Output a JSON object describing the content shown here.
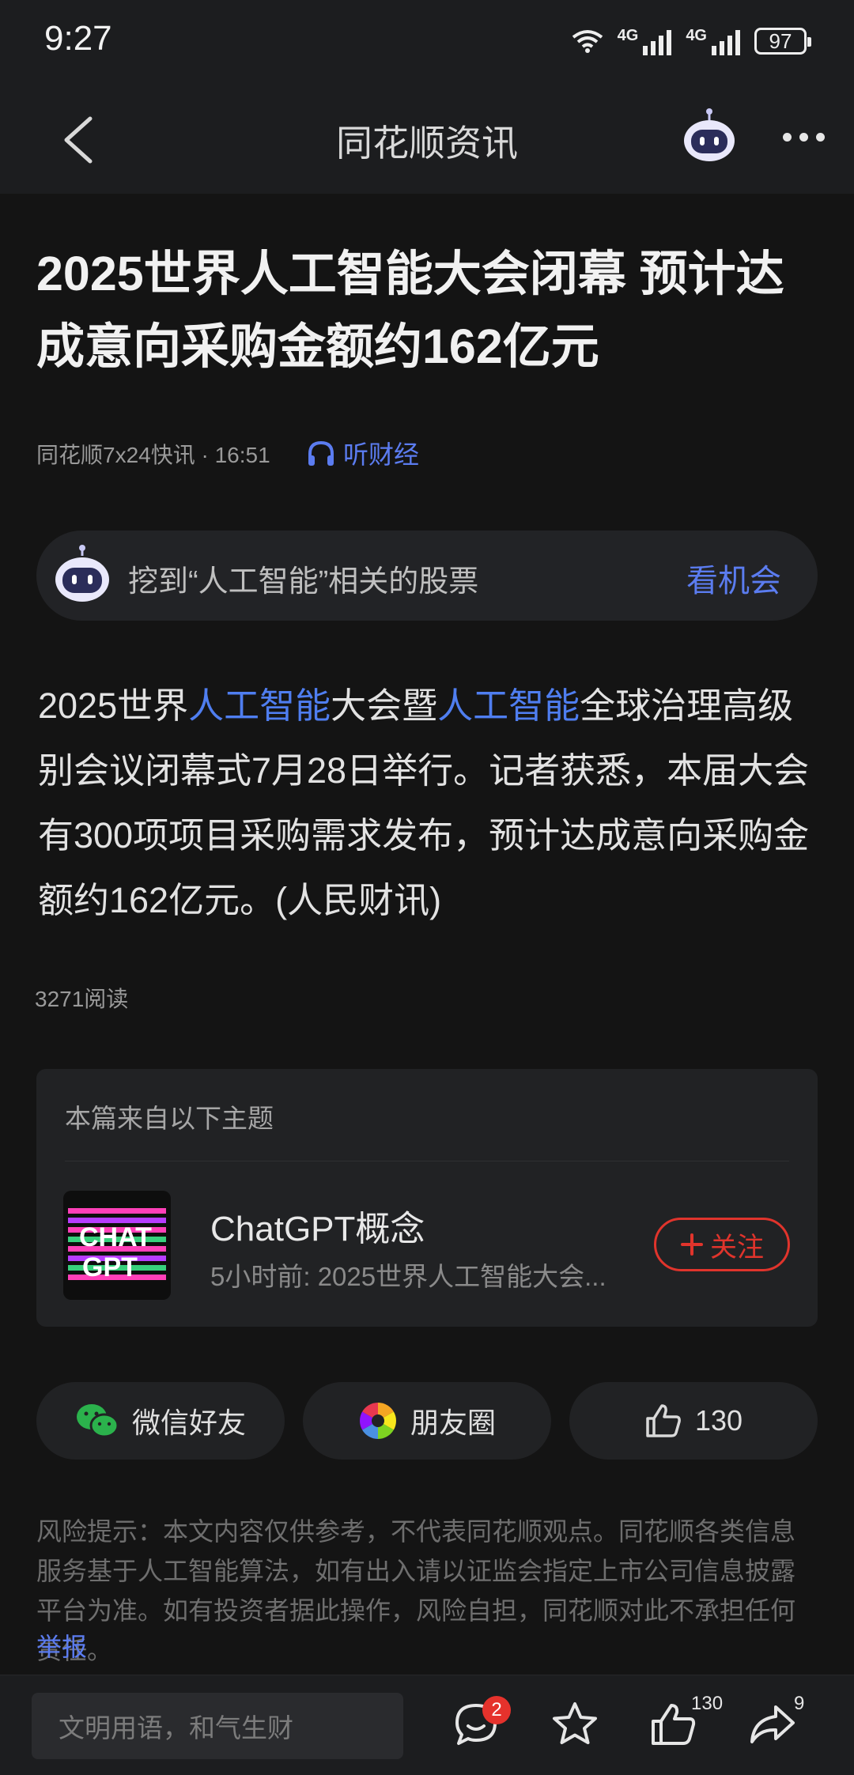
{
  "status_bar": {
    "time": "9:27",
    "network_1": "4G",
    "network_2": "4G",
    "battery": "97"
  },
  "nav": {
    "title": "同花顺资讯"
  },
  "article": {
    "headline": "2025世界人工智能大会闭幕 预计达成意向采购金额约162亿元",
    "source_time": "同花顺7x24快讯 · 16:51",
    "listen_label": "听财经",
    "ai_prompt": "挖到“人工智能”相关的股票",
    "ai_link": "看机会",
    "body": {
      "p1": "2025世界",
      "kw1": "人工智能",
      "p2": "大会暨",
      "kw2": "人工智能",
      "p3": "全球治理高级别会议闭幕式7月28日举行。记者获悉，本届大会有300项项目采购需求发布，预计达成意向采购金额约162亿元。(人民财讯)"
    },
    "reads": "3271阅读"
  },
  "topic": {
    "header": "本篇来自以下主题",
    "thumb_text_1": "CHAT",
    "thumb_text_2": "GPT",
    "name": "ChatGPT概念",
    "desc": "5小时前: 2025世界人工智能大会...",
    "follow_label": "关注"
  },
  "share": {
    "wechat_label": "微信好友",
    "moments_label": "朋友圈",
    "like_count": "130"
  },
  "disclaimer": {
    "text": "风险提示：本文内容仅供参考，不代表同花顺观点。同花顺各类信息服务基于人工智能算法，如有出入请以证监会指定上市公司信息披露平台为准。如有投资者据此操作，风险自担，同花顺对此不承担任何责任。",
    "report_label": "举报"
  },
  "bottom_bar": {
    "comment_placeholder": "文明用语，和气生财",
    "comment_badge": "2",
    "like_count": "130",
    "share_count": "9"
  },
  "colors": {
    "accent_blue": "#5b7cf0",
    "keyword_blue": "#4f7ef0",
    "follow_red": "#e0342c",
    "background": "#141414"
  },
  "icons": [
    "wifi-icon",
    "signal-icon",
    "battery-icon",
    "back-icon",
    "robot-icon",
    "more-icon",
    "headphones-icon",
    "plus-icon",
    "wechat-icon",
    "moments-icon",
    "thumbs-up-icon",
    "comment-icon",
    "star-icon",
    "share-icon"
  ]
}
